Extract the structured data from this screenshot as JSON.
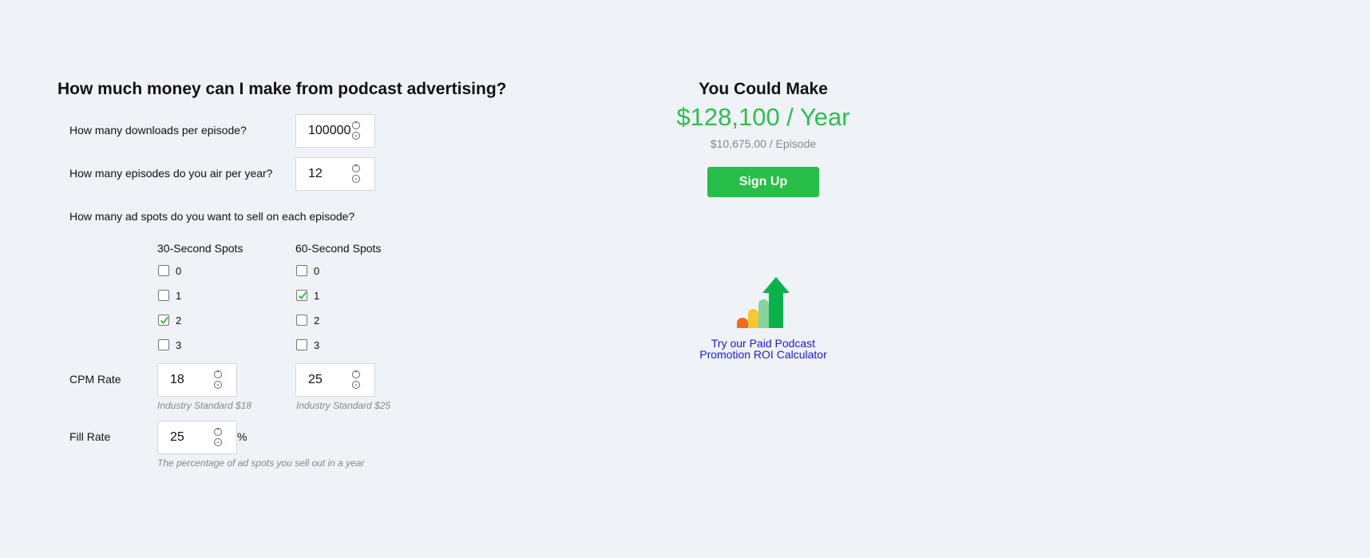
{
  "calculator": {
    "heading": "How much money can I make from podcast advertising?",
    "downloads": {
      "label": "How many downloads per episode?",
      "value": "100000"
    },
    "episodes": {
      "label": "How many episodes do you air per year?",
      "value": "12"
    },
    "spots_question": "How many ad spots do you want to sell on each episode?",
    "spots30": {
      "header": "30-Second Spots",
      "options": [
        "0",
        "1",
        "2",
        "3"
      ],
      "selected": "2"
    },
    "spots60": {
      "header": "60-Second Spots",
      "options": [
        "0",
        "1",
        "2",
        "3"
      ],
      "selected": "1"
    },
    "cpm": {
      "label": "CPM Rate",
      "value30": "18",
      "hint30": "Industry Standard $18",
      "value60": "25",
      "hint60": "Industry Standard $25"
    },
    "fill": {
      "label": "Fill Rate",
      "value": "25",
      "unit": "%",
      "hint": "The percentage of ad spots you sell out in a year"
    },
    "spinner_up": "^",
    "spinner_down": "v"
  },
  "result": {
    "title": "You Could Make",
    "amount": "$128,100 / Year",
    "per_episode": "$10,675.00 / Episode",
    "signup_label": "Sign Up",
    "roi_icon": "growth-chart-icon",
    "roi_link_line1": "Try our Paid Podcast",
    "roi_link_line2": "Promotion ROI Calculator"
  },
  "colors": {
    "background": "#eff2f7",
    "accent_green": "#2ebd4e",
    "button_green": "#28bd48",
    "link_blue": "#1a1adb",
    "checkmark_green": "#4caf50"
  }
}
